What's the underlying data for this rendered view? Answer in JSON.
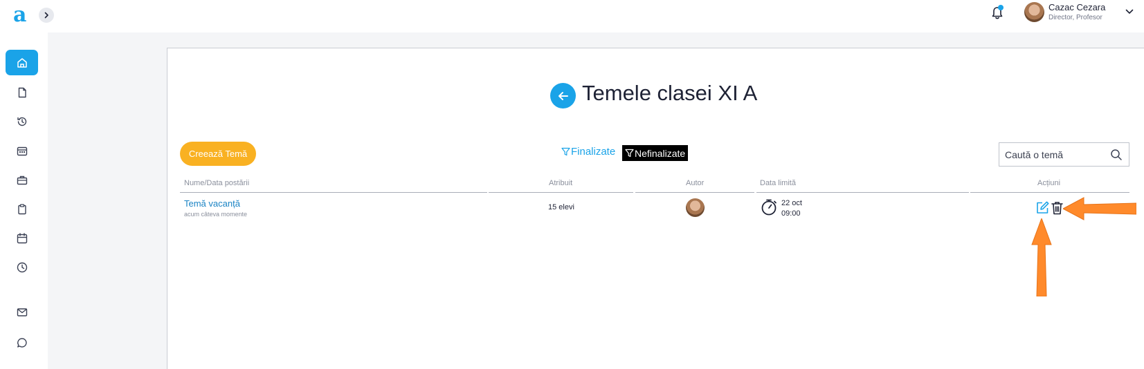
{
  "app": {
    "logo_text": "a",
    "accent_color": "#1aa3e8",
    "create_color": "#f9b122",
    "annotation_color": "#ff8a2b"
  },
  "user": {
    "name": "Cazac Cezara",
    "role": "Director, Profesor",
    "has_notification": true
  },
  "sidebar": {
    "items": [
      {
        "icon": "home-icon",
        "active": true
      },
      {
        "icon": "document-icon",
        "active": false
      },
      {
        "icon": "history-icon",
        "active": false
      },
      {
        "icon": "calendar-card-icon",
        "active": false
      },
      {
        "icon": "briefcase-icon",
        "active": false
      },
      {
        "icon": "clipboard-icon",
        "active": false
      },
      {
        "icon": "calendar-icon",
        "active": false
      },
      {
        "icon": "clock-icon",
        "active": false
      },
      {
        "icon": "mail-icon",
        "active": false
      },
      {
        "icon": "chat-icon",
        "active": false
      }
    ]
  },
  "page": {
    "title": "Temele clasei XI A"
  },
  "toolbar": {
    "create_label": "Creează Temă",
    "filter_finalized": "Finalizate",
    "filter_unfinalized": "Nefinalizate",
    "active_filter": "Nefinalizate",
    "search_placeholder": "Caută o temă"
  },
  "table": {
    "columns": [
      "Nume/Data postării",
      "Atribuit",
      "Autor",
      "Data limită",
      "Acțiuni"
    ],
    "rows": [
      {
        "name": "Temă vacanță",
        "posted": "acum câteva momente",
        "assigned": "15 elevi",
        "author_avatar": "avatar",
        "due_day": "22 oct",
        "due_time": "09:00",
        "actions": [
          "edit-icon",
          "delete-icon"
        ]
      }
    ]
  }
}
